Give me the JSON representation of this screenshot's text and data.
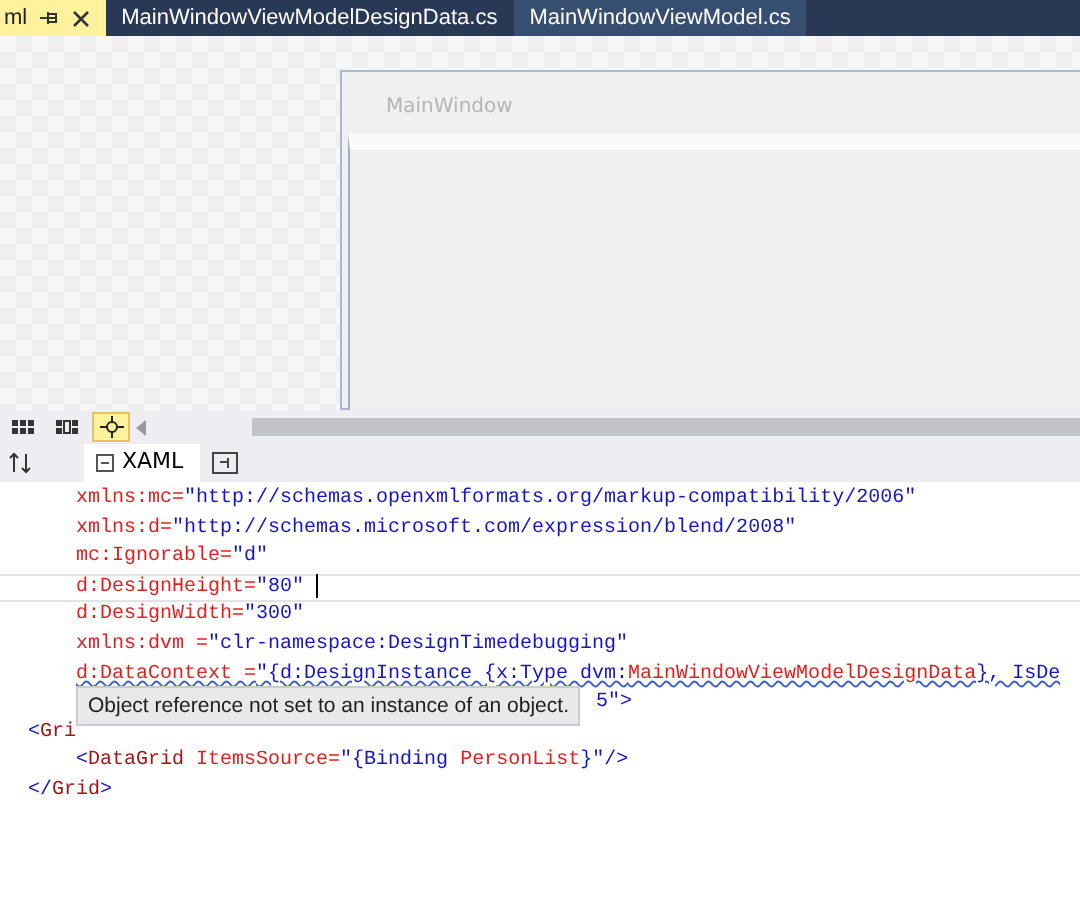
{
  "document_tabs": [
    {
      "label": "ml",
      "selected": true,
      "pinned": true,
      "closable": true
    },
    {
      "label": "MainWindowViewModelDesignData.cs",
      "selected": false,
      "pinned": false,
      "closable": false
    },
    {
      "label": "MainWindowViewModel.cs",
      "selected": false,
      "pinned": false,
      "closable": false
    }
  ],
  "designer": {
    "window_title": "MainWindow"
  },
  "view_buttons": [
    {
      "kind": "grid",
      "selected": false
    },
    {
      "kind": "snap",
      "selected": false
    },
    {
      "kind": "pointer",
      "selected": true
    }
  ],
  "editor_tabs": [
    {
      "label": "XAML",
      "selected": true
    }
  ],
  "code_lines": [
    {
      "indent": true,
      "current": false,
      "tokens": [
        {
          "kind": "attr",
          "text": "xmlns:mc="
        },
        {
          "kind": "value",
          "text": "\"http://schemas.openxmlformats.org/markup-compatibility/2006\""
        }
      ]
    },
    {
      "indent": true,
      "current": false,
      "tokens": [
        {
          "kind": "attr",
          "text": "xmlns:d="
        },
        {
          "kind": "value",
          "text": "\"http://schemas.microsoft.com/expression/blend/2008\""
        }
      ]
    },
    {
      "indent": true,
      "current": false,
      "tokens": [
        {
          "kind": "attr",
          "text": "mc:Ignorable="
        },
        {
          "kind": "value",
          "text": "\"d\""
        }
      ]
    },
    {
      "indent": true,
      "current": true,
      "tokens": [
        {
          "kind": "attr",
          "text": "d:DesignHeight="
        },
        {
          "kind": "value",
          "text": "\"80\""
        }
      ]
    },
    {
      "indent": true,
      "current": false,
      "tokens": [
        {
          "kind": "attr",
          "text": "d:DesignWidth="
        },
        {
          "kind": "value",
          "text": "\"300\""
        }
      ]
    },
    {
      "indent": true,
      "current": false,
      "tokens": [
        {
          "kind": "attr",
          "text": "xmlns:dvm ="
        },
        {
          "kind": "value",
          "text": "\"clr-namespace:DesignTimedebugging\""
        }
      ]
    },
    {
      "indent": true,
      "current": false,
      "error": true,
      "tokens": [
        {
          "kind": "attr",
          "text": "d:DataContext ="
        },
        {
          "kind": "value",
          "text": "\"{d:DesignInstance {x:Type dvm:"
        },
        {
          "kind": "attr",
          "text": "MainWindowViewModelDesignData"
        },
        {
          "kind": "value",
          "text": "}, IsDe"
        }
      ]
    },
    {
      "current": false,
      "covered": true,
      "tokens": [
        {
          "kind": "value",
          "text": "5\">"
        }
      ]
    },
    {
      "indent": false,
      "current": false,
      "tokens": [
        {
          "kind": "value",
          "text": "<"
        },
        {
          "kind": "tag",
          "text": "Gri"
        }
      ]
    },
    {
      "indent": true,
      "current": false,
      "tokens": [
        {
          "kind": "value",
          "text": "<"
        },
        {
          "kind": "tag",
          "text": "DataGrid "
        },
        {
          "kind": "attr",
          "text": "ItemsSource="
        },
        {
          "kind": "value",
          "text": "\"{Binding "
        },
        {
          "kind": "attr",
          "text": "PersonList"
        },
        {
          "kind": "value",
          "text": "}\"/>"
        }
      ]
    },
    {
      "indent": false,
      "current": false,
      "tokens": [
        {
          "kind": "value",
          "text": "</"
        },
        {
          "kind": "tag",
          "text": "Grid"
        },
        {
          "kind": "value",
          "text": ">"
        }
      ]
    }
  ],
  "tooltip": "Object reference not set to an instance of an object."
}
